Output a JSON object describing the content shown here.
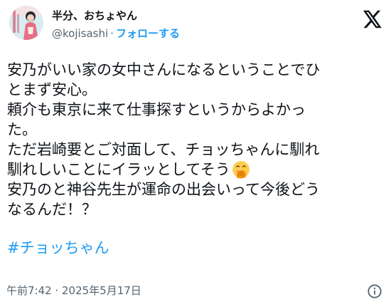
{
  "author": {
    "display_name": "半分、おちょやん",
    "handle": "@kojisashi",
    "separator": "·",
    "follow_label": "フォローする"
  },
  "tweet": {
    "lines": [
      "安乃がいい家の女中さんになるということでひ",
      "とまず安心。",
      "頼介も東京に来て仕事探すというからよかっ",
      "た。",
      "ただ岩崎要とご対面して、チョッちゃんに馴れ",
      "馴れしいことにイラッとしてそう",
      "安乃のと神谷先生が運命の出会いって今後どう",
      "なるんだ！？"
    ],
    "hashtag": "#チョッちゃん",
    "timestamp": "午前7:42 · 2025年5月17日"
  },
  "icons": {
    "logo": "x-logo-icon",
    "emoji": "face-with-hand-over-mouth-emoji",
    "info": "info-icon"
  },
  "colors": {
    "text": "#0f1419",
    "secondary": "#536471",
    "link": "#1d9bf0",
    "background": "#ffffff"
  }
}
